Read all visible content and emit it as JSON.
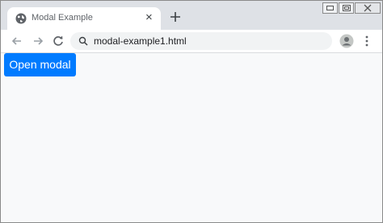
{
  "tab": {
    "title": "Modal Example",
    "close_glyph": "×",
    "favicon": "globe-icon"
  },
  "newtab": {
    "icon": "plus-icon"
  },
  "window_controls": [
    "minimize-icon",
    "maximize-icon",
    "close-icon"
  ],
  "toolbar": {
    "back_icon": "arrow-left-icon",
    "forward_icon": "arrow-right-icon",
    "reload_icon": "reload-icon",
    "address": "modal-example1.html",
    "profile_icon": "avatar-icon",
    "menu_icon": "kebab-menu-icon"
  },
  "page": {
    "button_label": "Open modal"
  },
  "colors": {
    "primary": "#007bff",
    "titlebar": "#dee1e6",
    "omnibox": "#f1f3f4"
  }
}
